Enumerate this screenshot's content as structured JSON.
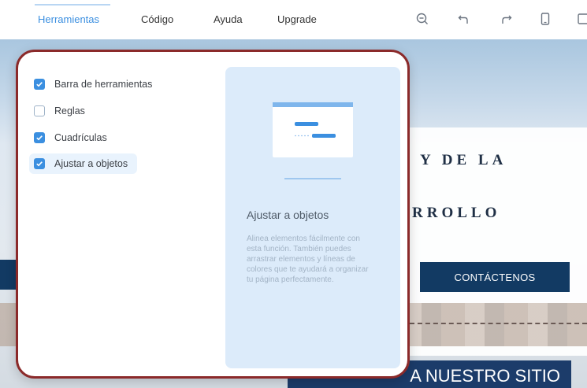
{
  "menu": {
    "items": [
      {
        "label": "Herramientas",
        "active": true
      },
      {
        "label": "Código",
        "active": false
      },
      {
        "label": "Ayuda",
        "active": false
      },
      {
        "label": "Upgrade",
        "active": false
      }
    ]
  },
  "toolbar": {
    "icons": [
      "zoom-out-icon",
      "undo-icon",
      "redo-icon",
      "mobile-icon",
      "preview-icon"
    ]
  },
  "panel": {
    "options": [
      {
        "label": "Barra de herramientas",
        "checked": true
      },
      {
        "label": "Reglas",
        "checked": false
      },
      {
        "label": "Cuadrículas",
        "checked": true
      },
      {
        "label": "Ajustar a objetos",
        "checked": true,
        "highlighted": true
      }
    ],
    "info": {
      "title": "Ajustar a objetos",
      "description": "Alinea elementos fácilmente con esta función. También puedes arrastrar elementos y líneas de colores que te ayudará a organizar tu página perfectamente."
    }
  },
  "background": {
    "heading_line1": "Y DE LA",
    "heading_line2": "RROLLO",
    "button_label": "CONTÁCTENOS",
    "banner_text": "A NUESTRO SITIO"
  },
  "colors": {
    "accent": "#3b8fe0",
    "panel_border": "#8b2a2a",
    "info_bg": "#dcebfa",
    "site_button": "#123a63"
  }
}
